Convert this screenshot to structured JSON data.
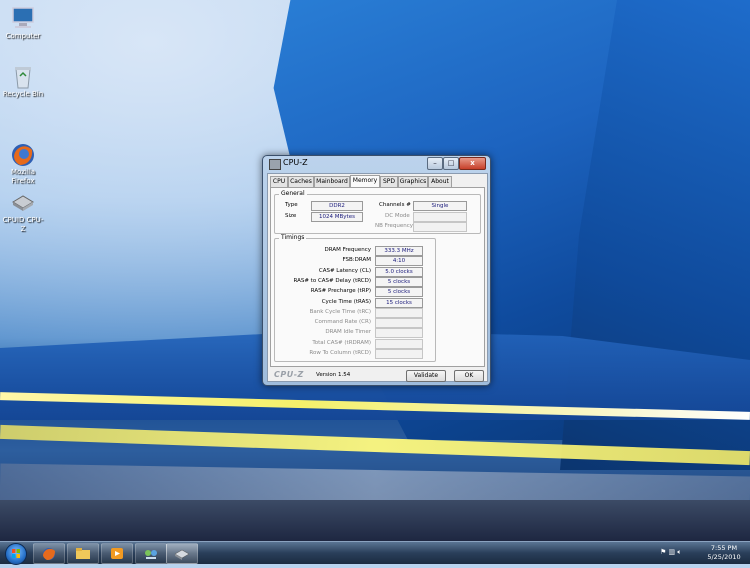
{
  "desktop": {
    "icons": [
      {
        "label": "Computer",
        "icon": "computer-icon"
      },
      {
        "label": "Recycle Bin",
        "icon": "recycle-bin-icon"
      },
      {
        "label": "Mozilla\nFirefox",
        "icon": "firefox-icon"
      },
      {
        "label": "CPUID CPU-Z",
        "icon": "cpuz-icon"
      }
    ]
  },
  "window": {
    "title": "CPU-Z",
    "min_label": "–",
    "max_label": "□",
    "close_label": "x",
    "tabs": [
      "CPU",
      "Caches",
      "Mainboard",
      "Memory",
      "SPD",
      "Graphics",
      "About"
    ],
    "active_tab": "Memory",
    "general": {
      "group_label": "General",
      "type_label": "Type",
      "type_value": "DDR2",
      "size_label": "Size",
      "size_value": "1024 MBytes",
      "channels_label": "Channels #",
      "channels_value": "Single",
      "dc_mode_label": "DC Mode",
      "dc_mode_value": "",
      "nb_freq_label": "NB Frequency",
      "nb_freq_value": ""
    },
    "timings": {
      "group_label": "Timings",
      "rows": [
        {
          "label": "DRAM Frequency",
          "value": "333.3 MHz",
          "enabled": true
        },
        {
          "label": "FSB:DRAM",
          "value": "4:10",
          "enabled": true
        },
        {
          "label": "CAS# Latency (CL)",
          "value": "5.0 clocks",
          "enabled": true
        },
        {
          "label": "RAS# to CAS# Delay (tRCD)",
          "value": "5 clocks",
          "enabled": true
        },
        {
          "label": "RAS# Precharge (tRP)",
          "value": "5 clocks",
          "enabled": true
        },
        {
          "label": "Cycle Time (tRAS)",
          "value": "15 clocks",
          "enabled": true
        },
        {
          "label": "Bank Cycle Time (tRC)",
          "value": "",
          "enabled": false
        },
        {
          "label": "Command Rate (CR)",
          "value": "",
          "enabled": false
        },
        {
          "label": "DRAM Idle Timer",
          "value": "",
          "enabled": false
        },
        {
          "label": "Total CAS# (tRDRAM)",
          "value": "",
          "enabled": false
        },
        {
          "label": "Row To Column (tRCD)",
          "value": "",
          "enabled": false
        }
      ]
    },
    "footer": {
      "logo": "CPU-Z",
      "version": "Version 1.54",
      "validate_label": "Validate",
      "ok_label": "OK"
    }
  },
  "taskbar": {
    "items": [
      "firefox-icon",
      "folder-icon",
      "media-player-icon",
      "network-icon",
      "cpuz-icon"
    ],
    "tray_icons": [
      "flag-icon",
      "network-tray-icon",
      "volume-icon"
    ],
    "time": "7:55 PM",
    "date": "5/25/2010"
  }
}
